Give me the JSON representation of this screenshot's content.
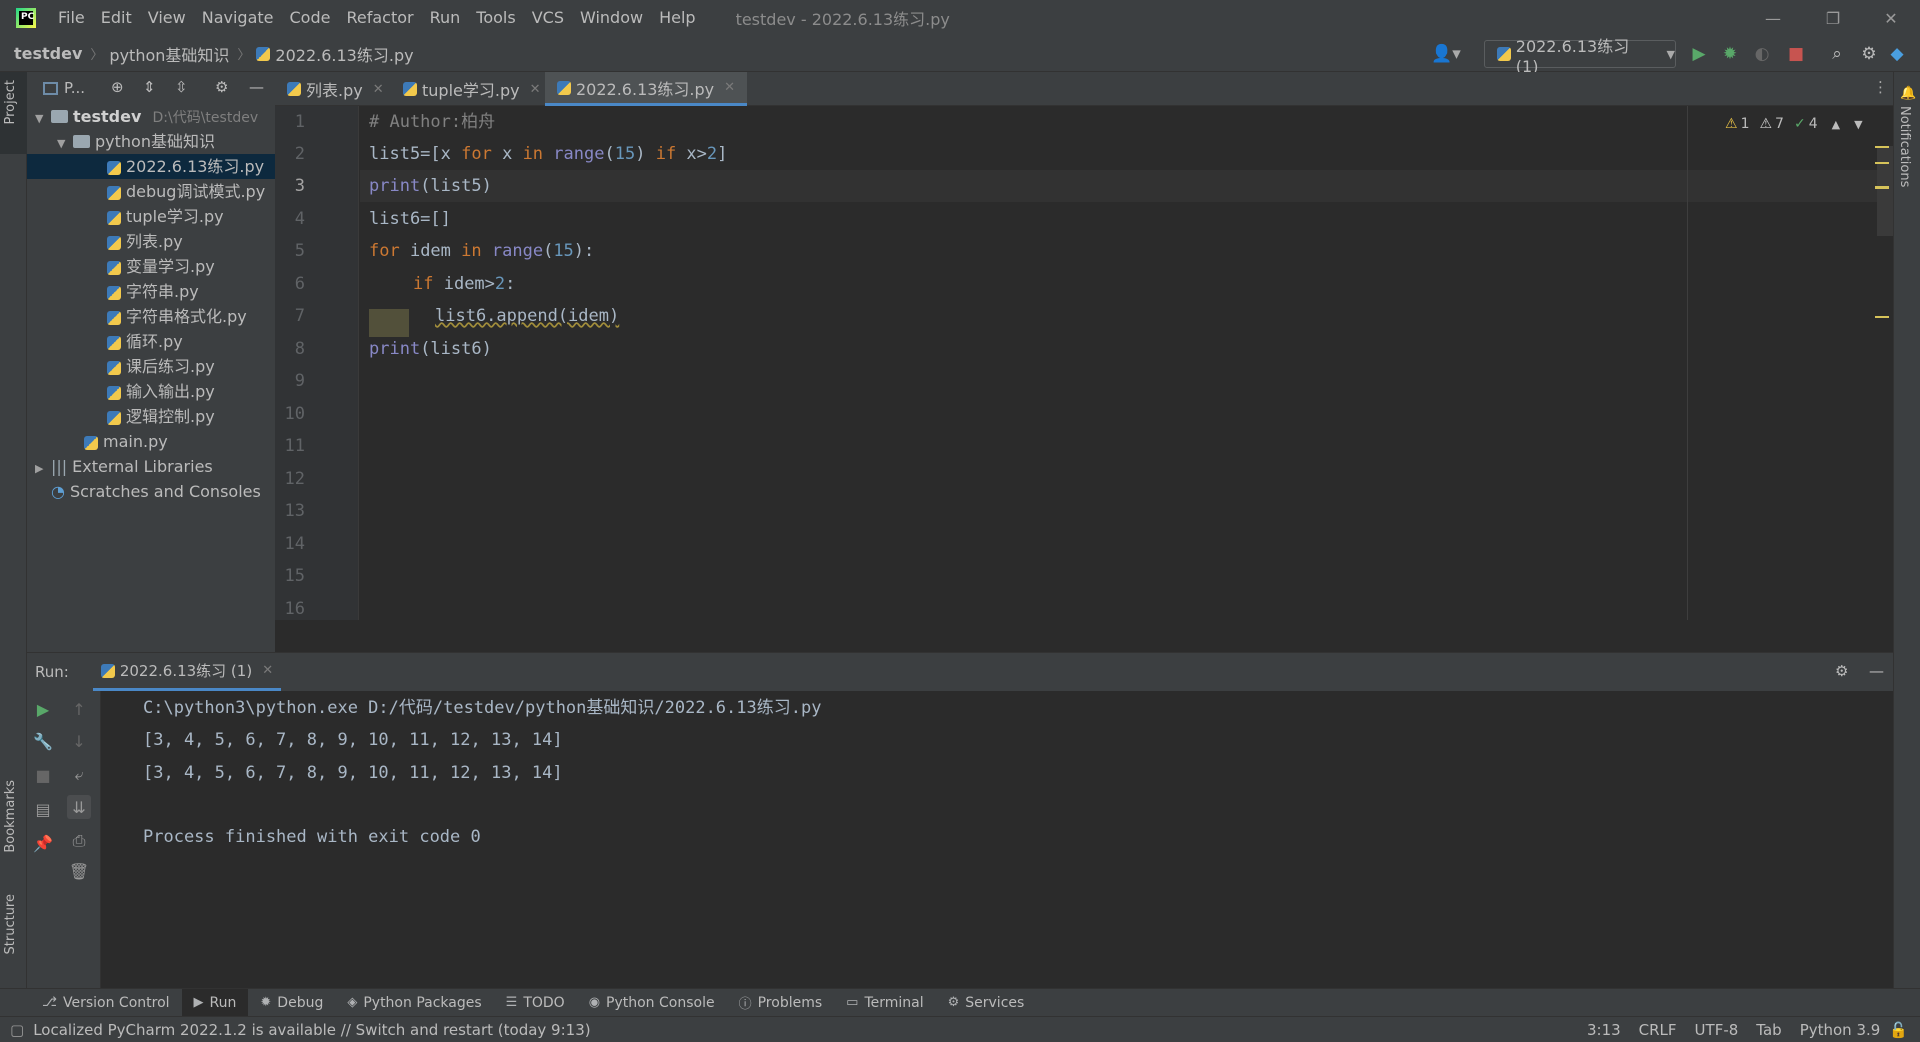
{
  "window": {
    "title": "testdev - 2022.6.13练习.py",
    "logo": "PC"
  },
  "menu": [
    "File",
    "Edit",
    "View",
    "Navigate",
    "Code",
    "Refactor",
    "Run",
    "Tools",
    "VCS",
    "Window",
    "Help"
  ],
  "breadcrumb": [
    "testdev",
    "python基础知识",
    "2022.6.13练习.py"
  ],
  "run_config": "2022.6.13练习 (1)",
  "left_strip": {
    "project": "Project",
    "bookmarks": "Bookmarks",
    "structure": "Structure"
  },
  "right_strip": {
    "notifications": "Notifications"
  },
  "project_panel": {
    "header": "P...",
    "root": {
      "name": "testdev",
      "path": "D:\\代码\\testdev"
    },
    "folder": "python基础知识",
    "files": [
      "2022.6.13练习.py",
      "debug调试模式.py",
      "tuple学习.py",
      "列表.py",
      "变量学习.py",
      "字符串.py",
      "字符串格式化.py",
      "循环.py",
      "课后练习.py",
      "输入输出.py",
      "逻辑控制.py"
    ],
    "selected_file": "2022.6.13练习.py",
    "main": "main.py",
    "external": "External Libraries",
    "scratches": "Scratches and Consoles"
  },
  "editor_tabs": [
    "列表.py",
    "tuple学习.py",
    "2022.6.13练习.py"
  ],
  "active_tab": "2022.6.13练习.py",
  "editor": {
    "line_numbers": [
      "1",
      "2",
      "3",
      "4",
      "5",
      "6",
      "7",
      "8",
      "9",
      "10",
      "11",
      "12",
      "13",
      "14",
      "15",
      "16"
    ],
    "current_line": 3,
    "code": {
      "l1": "# Author:柏舟",
      "l2": {
        "a": "list5=[x ",
        "b": "for",
        "c": " x ",
        "d": "in",
        "e": " ",
        "f": "range",
        "g": "(",
        "h": "15",
        "i": ") ",
        "j": "if",
        "k": " x>",
        "l": "2",
        "m": "]"
      },
      "l3": {
        "a": "print",
        "b": "(list5)"
      },
      "l4": "list6=[]",
      "l5": {
        "a": "for",
        "b": " idem ",
        "c": "in",
        "d": " ",
        "e": "range",
        "f": "(",
        "g": "15",
        "h": "):"
      },
      "l6": {
        "a": "if",
        "b": " idem>",
        "c": "2",
        "d": ":"
      },
      "l7": "list6.append(idem)",
      "l8": {
        "a": "print",
        "b": "(list6)"
      }
    },
    "inspections": {
      "warnings_a": "1",
      "warnings_b": "7",
      "ok": "4"
    }
  },
  "run_panel": {
    "label": "Run:",
    "tab": "2022.6.13练习 (1)",
    "output": [
      "C:\\python3\\python.exe D:/代码/testdev/python基础知识/2022.6.13练习.py",
      "[3, 4, 5, 6, 7, 8, 9, 10, 11, 12, 13, 14]",
      "[3, 4, 5, 6, 7, 8, 9, 10, 11, 12, 13, 14]",
      "",
      "Process finished with exit code 0"
    ]
  },
  "bottom_tabs": [
    "Version Control",
    "Run",
    "Debug",
    "Python Packages",
    "TODO",
    "Python Console",
    "Problems",
    "Terminal",
    "Services"
  ],
  "active_bottom_tab": "Run",
  "status": {
    "message": "Localized PyCharm 2022.1.2 is available // Switch and restart (today 9:13)",
    "position": "3:13",
    "line_sep": "CRLF",
    "encoding": "UTF-8",
    "indent": "Tab",
    "interpreter": "Python 3.9"
  },
  "colors": {
    "keyword": "#cc7832",
    "number": "#6897bb",
    "builtin": "#8888c6",
    "comment": "#808080",
    "accent": "#4a88c7"
  }
}
